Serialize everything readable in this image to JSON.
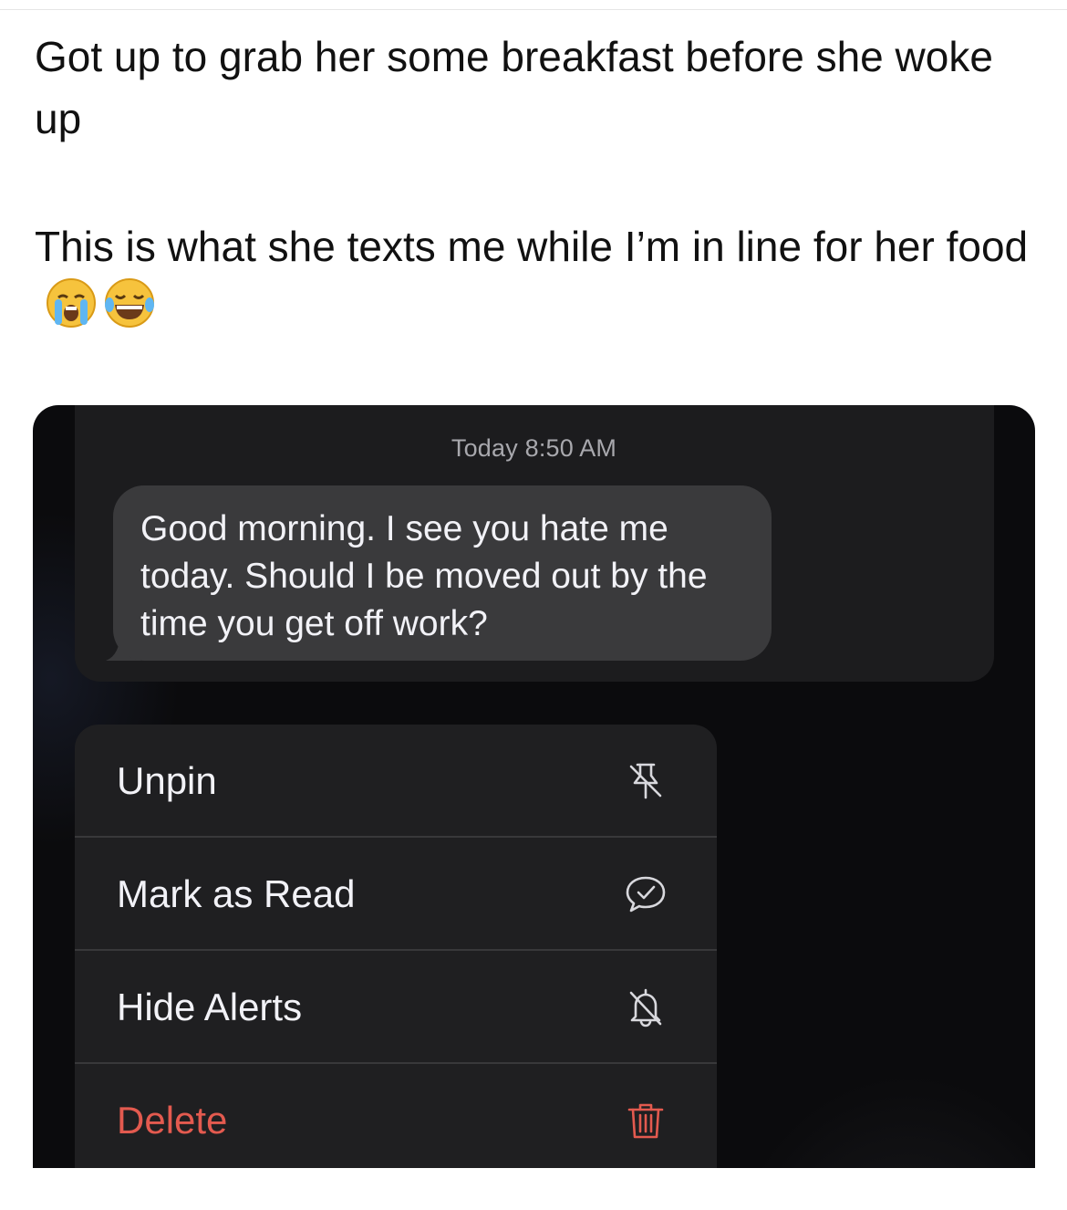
{
  "post": {
    "caption_line_1": "Got up to grab her some breakfast before she woke up",
    "caption_line_2": "This is what she texts me while I’m in line for her food",
    "emojis": [
      "loudly-crying-face-icon",
      "face-with-tears-of-joy-icon"
    ]
  },
  "conversation": {
    "timestamp": "Today 8:50 AM",
    "message": "Good morning. I see you hate me today. Should I be moved out by the time you get off work?"
  },
  "context_menu": {
    "items": [
      {
        "label": "Unpin",
        "icon": "unpin-icon"
      },
      {
        "label": "Mark as Read",
        "icon": "mark-read-bubble-icon"
      },
      {
        "label": "Hide Alerts",
        "icon": "bell-slash-icon"
      },
      {
        "label": "Delete",
        "icon": "trash-icon",
        "destructive": true
      }
    ]
  },
  "colors": {
    "background": "#0b0b0d",
    "bubble": "#3a3a3c",
    "menu": "#1f1f21",
    "destructive": "#e35a4f"
  }
}
